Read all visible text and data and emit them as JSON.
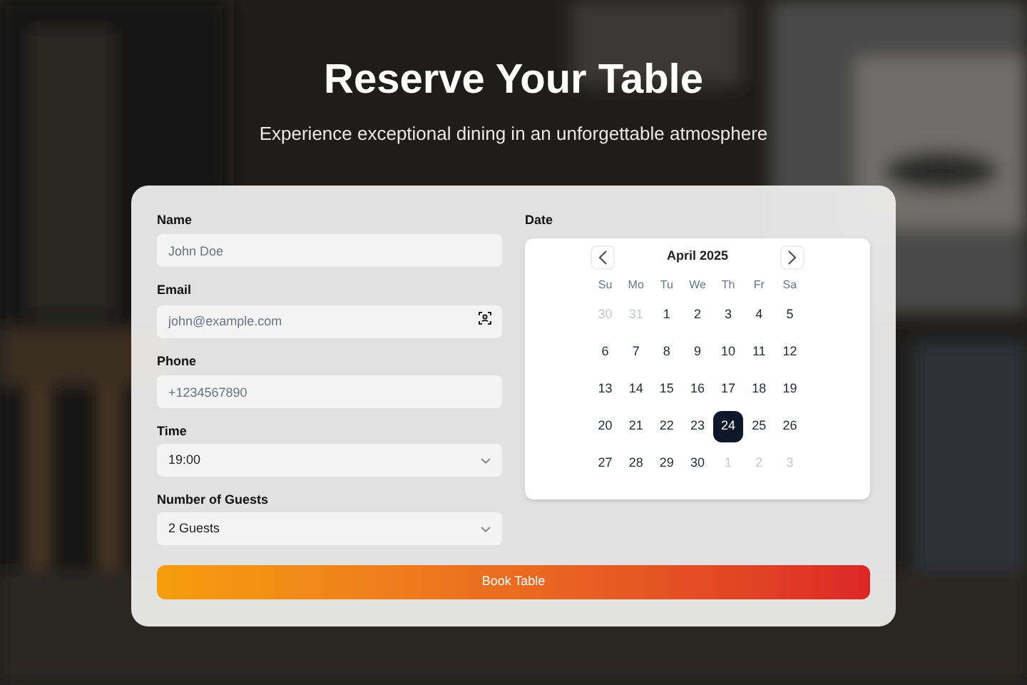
{
  "header": {
    "title": "Reserve Your Table",
    "subtitle": "Experience exceptional dining in an unforgettable atmosphere"
  },
  "form": {
    "fields": [
      {
        "label": "Name",
        "kind": "text",
        "placeholder": "John Doe",
        "icon": false
      },
      {
        "label": "Email",
        "kind": "text",
        "placeholder": "john@example.com",
        "icon": true
      },
      {
        "label": "Phone",
        "kind": "text",
        "placeholder": "+1234567890",
        "icon": false
      },
      {
        "label": "Time",
        "kind": "select",
        "value": "19:00"
      },
      {
        "label": "Number of Guests",
        "kind": "select",
        "value": "2 Guests"
      }
    ],
    "date": {
      "label": "Date",
      "month": "April 2025",
      "weekdays": [
        "Su",
        "Mo",
        "Tu",
        "We",
        "Th",
        "Fr",
        "Sa"
      ],
      "days": [
        {
          "label": "30",
          "outside": true,
          "selected": false
        },
        {
          "label": "31",
          "outside": true,
          "selected": false
        },
        {
          "label": "1",
          "outside": false,
          "selected": false
        },
        {
          "label": "2",
          "outside": false,
          "selected": false
        },
        {
          "label": "3",
          "outside": false,
          "selected": false
        },
        {
          "label": "4",
          "outside": false,
          "selected": false
        },
        {
          "label": "5",
          "outside": false,
          "selected": false
        },
        {
          "label": "6",
          "outside": false,
          "selected": false
        },
        {
          "label": "7",
          "outside": false,
          "selected": false
        },
        {
          "label": "8",
          "outside": false,
          "selected": false
        },
        {
          "label": "9",
          "outside": false,
          "selected": false
        },
        {
          "label": "10",
          "outside": false,
          "selected": false
        },
        {
          "label": "11",
          "outside": false,
          "selected": false
        },
        {
          "label": "12",
          "outside": false,
          "selected": false
        },
        {
          "label": "13",
          "outside": false,
          "selected": false
        },
        {
          "label": "14",
          "outside": false,
          "selected": false
        },
        {
          "label": "15",
          "outside": false,
          "selected": false
        },
        {
          "label": "16",
          "outside": false,
          "selected": false
        },
        {
          "label": "17",
          "outside": false,
          "selected": false
        },
        {
          "label": "18",
          "outside": false,
          "selected": false
        },
        {
          "label": "19",
          "outside": false,
          "selected": false
        },
        {
          "label": "20",
          "outside": false,
          "selected": false
        },
        {
          "label": "21",
          "outside": false,
          "selected": false
        },
        {
          "label": "22",
          "outside": false,
          "selected": false
        },
        {
          "label": "23",
          "outside": false,
          "selected": false
        },
        {
          "label": "24",
          "outside": false,
          "selected": true
        },
        {
          "label": "25",
          "outside": false,
          "selected": false
        },
        {
          "label": "26",
          "outside": false,
          "selected": false
        },
        {
          "label": "27",
          "outside": false,
          "selected": false
        },
        {
          "label": "28",
          "outside": false,
          "selected": false
        },
        {
          "label": "29",
          "outside": false,
          "selected": false
        },
        {
          "label": "30",
          "outside": false,
          "selected": false
        },
        {
          "label": "1",
          "outside": true,
          "selected": false
        },
        {
          "label": "2",
          "outside": true,
          "selected": false
        },
        {
          "label": "3",
          "outside": true,
          "selected": false
        }
      ]
    },
    "submit": "Book Table"
  }
}
